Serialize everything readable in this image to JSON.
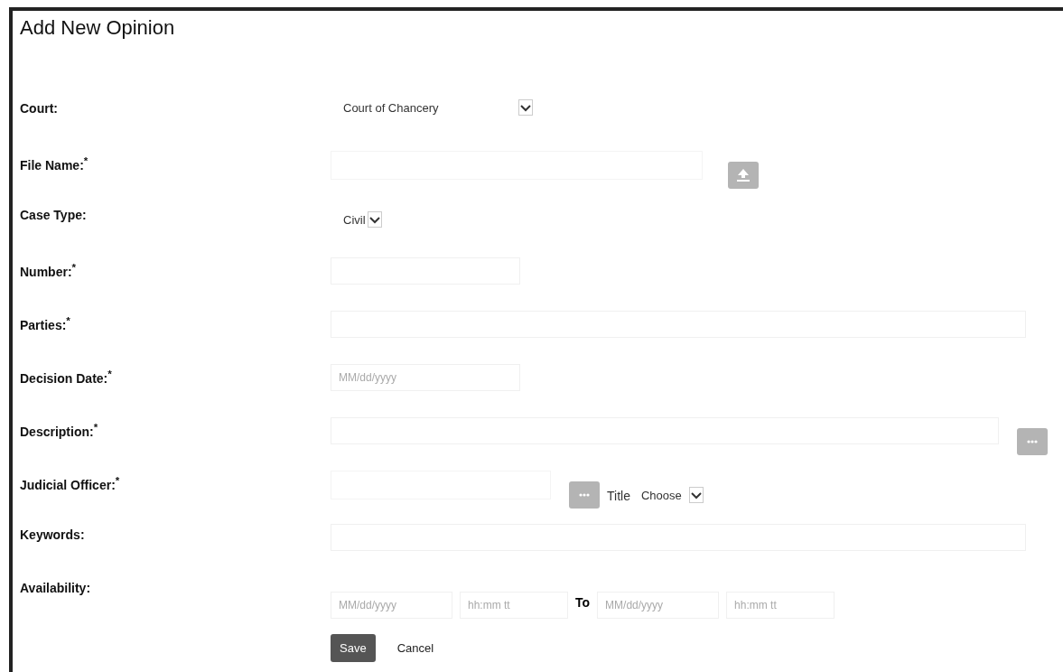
{
  "title": "Add New Opinion",
  "rows": [
    {
      "kind": "widesel",
      "label": "Court:",
      "value": "Court of Chancery"
    },
    {
      "kind": "file",
      "label": "File Name:$^{*}$"
    },
    {
      "kind": "narrowsel",
      "label": "Case Type:",
      "value": "Civil"
    },
    {
      "kind": "shorttext",
      "label": "Number:$^{*}$"
    },
    {
      "kind": "longtext",
      "label": "Parties:$^{*}$"
    },
    {
      "kind": "date",
      "label": "Decision Date:$^{*}$",
      "placeholder": "MM/dd/yyyy"
    },
    {
      "kind": "lookup",
      "label": "Description:$^{*}$"
    },
    {
      "kind": "officer",
      "label": "Judicial Officer:$^{*}$",
      "title_label": "Title",
      "value": "Choose"
    },
    {
      "kind": "longtext",
      "label": "Keywords:"
    },
    {
      "kind": "range",
      "label": "Availability:",
      "from": [
        {
          "placeholder": "MM/dd/yyyy"
        },
        {
          "placeholder": "hh:mm tt"
        }
      ],
      "to_label": "To",
      "to": [
        {
          "placeholder": "MM/dd/yyyy"
        },
        {
          "placeholder": "hh:mm tt"
        }
      ]
    }
  ],
  "buttons": [
    {
      "label": "Save",
      "kind": "primary"
    },
    {
      "label": "Cancel",
      "kind": "plain"
    }
  ]
}
